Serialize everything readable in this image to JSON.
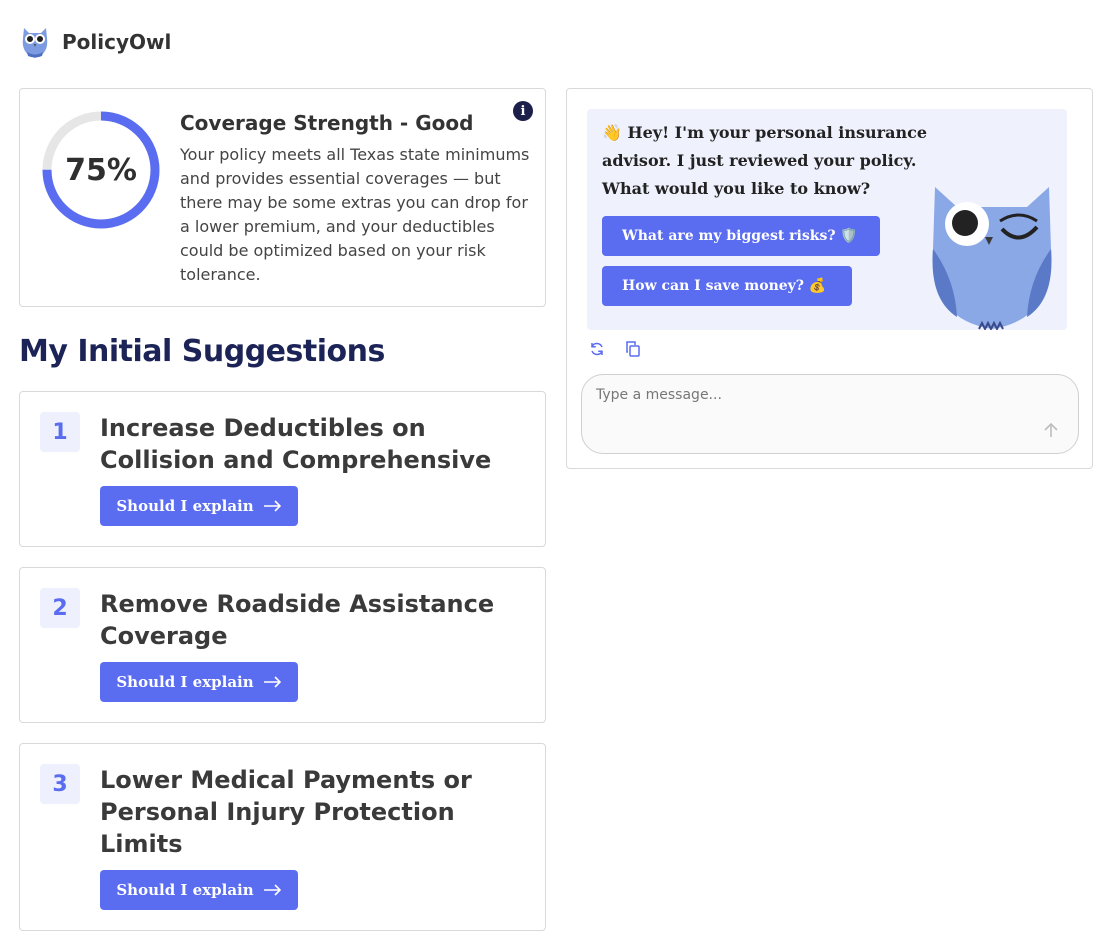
{
  "header": {
    "brand": "PolicyOwl",
    "logo_icon": "owl-logo-icon"
  },
  "coverage": {
    "percent": 75,
    "percent_label": "75%",
    "title": "Coverage Strength - Good",
    "description": "Your policy meets all Texas state minimums and provides essential coverages — but there may be some extras you can drop for a lower premium, and your deductibles could be optimized based on your risk tolerance.",
    "info_icon": "info-icon",
    "gauge_color": "#5a6cf0",
    "gauge_track_color": "#e6e6e6"
  },
  "suggestions": {
    "heading": "My Initial Suggestions",
    "items": [
      {
        "number": "1",
        "title": "Increase Deductibles on Collision and Comprehensive",
        "button": "Should I explain"
      },
      {
        "number": "2",
        "title": "Remove Roadside Assistance Coverage",
        "button": "Should I explain"
      },
      {
        "number": "3",
        "title": "Lower Medical Payments or Personal Injury Protection Limits",
        "button": "Should I explain"
      }
    ]
  },
  "chat": {
    "greeting": "👋 Hey! I'm your personal insurance advisor. I just reviewed your policy. What would you like to know?",
    "chips": [
      "What are my biggest risks? 🛡️",
      "How can I save money? 💰"
    ],
    "regenerate_icon": "refresh-icon",
    "copy_icon": "copy-icon",
    "input_placeholder": "Type a message...",
    "send_icon": "send-arrow-icon",
    "owl_icon": "winking-owl-icon"
  },
  "colors": {
    "accent": "#5a6cf0",
    "heading": "#1c2356",
    "bubble_bg": "#eff2fd",
    "owl_body": "#8aa8e6",
    "owl_dark": "#5a79c7"
  }
}
